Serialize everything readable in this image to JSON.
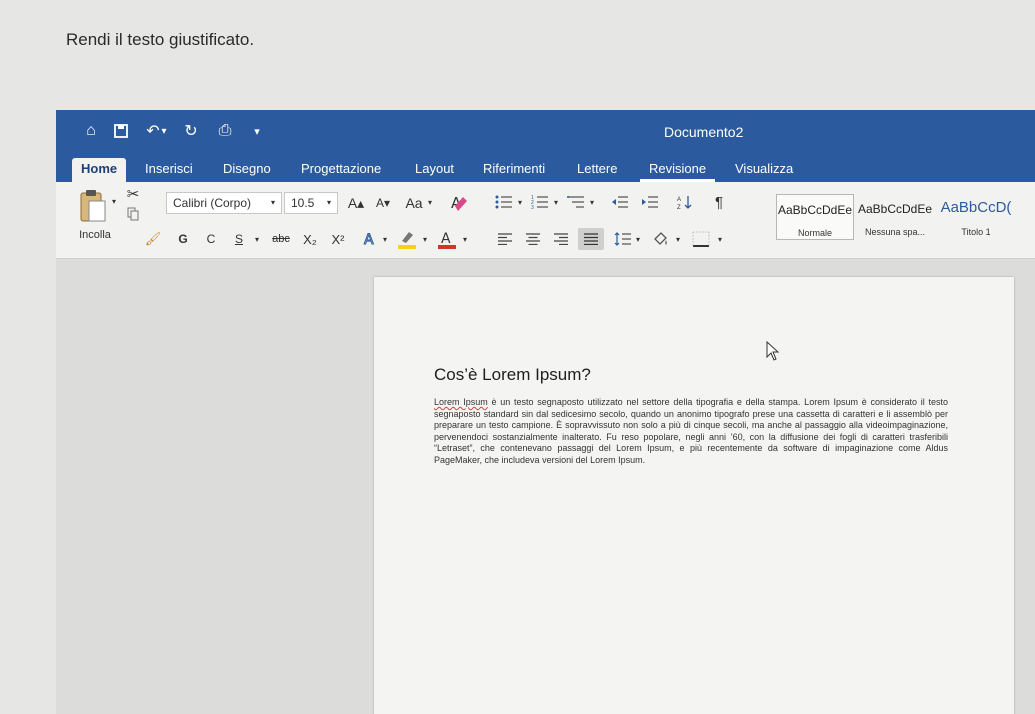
{
  "instruction": "Rendi il testo giustificato.",
  "window": {
    "title": "Documento2"
  },
  "quick_access": [
    {
      "name": "home-icon",
      "glyph": "⌂"
    },
    {
      "name": "save-icon",
      "glyph": "🖫"
    },
    {
      "name": "undo-icon",
      "glyph": "↶"
    },
    {
      "name": "undo-dropdown-icon",
      "glyph": "▾"
    },
    {
      "name": "redo-icon",
      "glyph": "↻"
    },
    {
      "name": "print-icon",
      "glyph": "⎙"
    },
    {
      "name": "customize-icon",
      "glyph": "▾"
    }
  ],
  "tabs": [
    "Home",
    "Inserisci",
    "Disegno",
    "Progettazione",
    "Layout",
    "Riferimenti",
    "Lettere",
    "Revisione",
    "Visualizza"
  ],
  "ribbon": {
    "paste_label": "Incolla",
    "font_name": "Calibri (Corpo)",
    "font_size": "10.5",
    "grow_font": "A▴",
    "shrink_font": "A▾",
    "change_case": "Aa",
    "bold": "G",
    "italic": "C",
    "underline": "S",
    "strikethrough": "abc",
    "subscript": "X₂",
    "superscript": "X²",
    "styles": [
      {
        "preview": "AaBbCcDdEe",
        "name": "Normale"
      },
      {
        "preview": "AaBbCcDdEe",
        "name": "Nessuna spa..."
      },
      {
        "preview": "AaBbCcD(",
        "name": "Titolo 1"
      }
    ]
  },
  "colors": {
    "brand": "#2b5a9e",
    "ribbon_bg": "#f2f2f0",
    "highlight": "#f4d21c",
    "font_color": "#d0342c"
  },
  "document": {
    "heading": "Cos’è Lorem Ipsum?",
    "para_lead": "Lorem Ipsum",
    "para_rest": " è un testo segnaposto utilizzato nel settore della tipografia e della stampa. Lorem Ipsum è considerato il testo segnaposto standard sin dal sedicesimo secolo, quando un anonimo tipografo prese una cassetta di caratteri e li assemblò per preparare un testo campione. È sopravvissuto non solo a più di cinque secoli, ma anche al passaggio alla videoimpaginazione, pervenendoci sostanzialmente inalterato. Fu reso popolare, negli anni ’60, con la diffusione dei fogli di caratteri trasferibili “Letraset”, che contenevano passaggi del Lorem Ipsum, e più recentemente da software di impaginazione come Aldus PageMaker, che includeva versioni del Lorem Ipsum."
  }
}
